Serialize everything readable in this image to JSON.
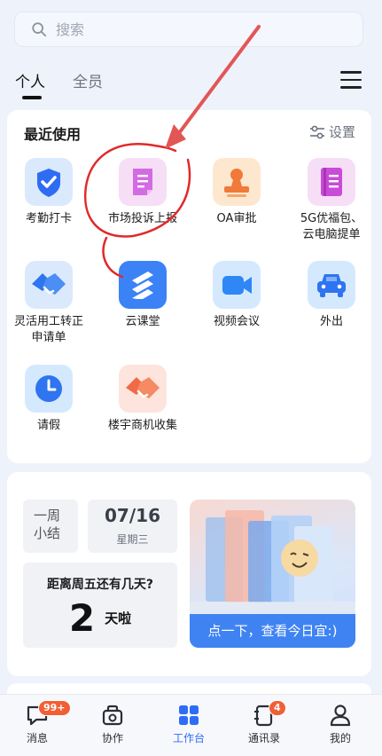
{
  "search": {
    "placeholder": "搜索"
  },
  "tabs": [
    {
      "label": "个人"
    },
    {
      "label": "全员"
    }
  ],
  "recent": {
    "title": "最近使用",
    "settings_label": "设置",
    "apps": [
      {
        "label": "考勤打卡",
        "icon": "attendance-shield-icon",
        "color": "#2f6cf4"
      },
      {
        "label": "市场投诉上报",
        "icon": "document-report-icon",
        "color": "#d36be3"
      },
      {
        "label": "OA审批",
        "icon": "approval-stamp-icon",
        "color": "#f07a3a"
      },
      {
        "label": "5G优福包、\n云电脑提单",
        "icon": "document-list-icon",
        "color": "#c94bd7"
      },
      {
        "label": "灵活用工转正\n申请单",
        "icon": "handshake-icon",
        "color": "#2f74f0"
      },
      {
        "label": "云课堂",
        "icon": "cloud-class-icon",
        "color": "#3b82f6"
      },
      {
        "label": "视频会议",
        "icon": "video-camera-icon",
        "color": "#2f86f5"
      },
      {
        "label": "外出",
        "icon": "car-icon",
        "color": "#2f74f0"
      },
      {
        "label": "请假",
        "icon": "clock-icon",
        "color": "#2f74f0"
      },
      {
        "label": "楼宇商机收集",
        "icon": "handshake-orange-icon",
        "color": "#f06a46"
      }
    ]
  },
  "week": {
    "summary_text": "一周\n小结",
    "date": "07/16",
    "weekday": "星期三",
    "countdown_question": "距离周五还有几天?",
    "countdown_number": "2",
    "countdown_unit": "天啦",
    "banner_text": "点一下，查看今日宜:)"
  },
  "nav": [
    {
      "label": "消息",
      "icon": "message-icon",
      "badge": "99+"
    },
    {
      "label": "协作",
      "icon": "collaborate-icon"
    },
    {
      "label": "工作台",
      "icon": "workbench-icon",
      "active": true
    },
    {
      "label": "通讯录",
      "icon": "contacts-icon",
      "badge": "4"
    },
    {
      "label": "我的",
      "icon": "profile-icon"
    }
  ]
}
